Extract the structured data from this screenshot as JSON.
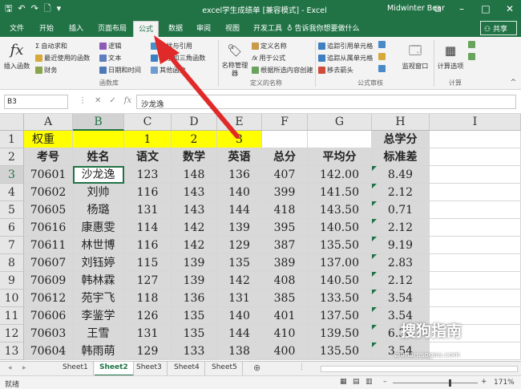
{
  "titlebar": {
    "title": "excel学生成绩单 [兼容模式] - Excel",
    "user": "Midwinter Bear",
    "qat_icons": [
      "save-icon",
      "undo-icon",
      "redo-icon",
      "new-file-icon",
      "more-icon"
    ]
  },
  "tabs": [
    "文件",
    "开始",
    "插入",
    "页面布局",
    "公式",
    "数据",
    "审阅",
    "视图",
    "开发工具"
  ],
  "active_tab": "公式",
  "tellme": "告诉我你想要做什么",
  "share": "共享",
  "ribbon": {
    "insert_function": "插入函数",
    "autosum": "自动求和",
    "recent": "最近使用的函数",
    "financial": "财务",
    "logical": "逻辑",
    "text": "文本",
    "datetime": "日期和时间",
    "lookup": "查找与引用",
    "math": "数学和三角函数",
    "other": "其他函数",
    "group_functions": "函数库",
    "name_manager": "名称管理器",
    "define_name": "定义名称",
    "use_in_formula": "用于公式",
    "create_from_sel": "根据所选内容创建",
    "group_names": "定义的名称",
    "trace_precedents": "追踪引用单元格",
    "trace_dependents": "追踪从属单元格",
    "remove_arrows": "移去箭头",
    "group_audit": "公式审核",
    "watch_window": "监视窗口",
    "calc_options": "计算选项",
    "group_calc": "计算"
  },
  "formulabar": {
    "name_box": "B3",
    "fx": "fx",
    "value": "沙龙逸"
  },
  "columns": [
    "A",
    "B",
    "C",
    "D",
    "E",
    "F",
    "G",
    "H",
    "I"
  ],
  "rows": [
    "1",
    "2",
    "3",
    "4",
    "5",
    "6",
    "7",
    "8",
    "9",
    "10",
    "11",
    "12",
    "13"
  ],
  "sheet": {
    "row1": {
      "a": "权重",
      "c": "1",
      "d": "2",
      "e": "3",
      "h": "总学分"
    },
    "headers": [
      "考号",
      "姓名",
      "语文",
      "数学",
      "英语",
      "总分",
      "平均分",
      "标准差"
    ],
    "data": [
      [
        "70601",
        "沙龙逸",
        "123",
        "148",
        "136",
        "407",
        "142.00",
        "8.49"
      ],
      [
        "70602",
        "刘帅",
        "116",
        "143",
        "140",
        "399",
        "141.50",
        "2.12"
      ],
      [
        "70605",
        "杨璐",
        "131",
        "143",
        "144",
        "418",
        "143.50",
        "0.71"
      ],
      [
        "70616",
        "康惠雯",
        "114",
        "142",
        "139",
        "395",
        "140.50",
        "2.12"
      ],
      [
        "70611",
        "林世博",
        "116",
        "142",
        "129",
        "387",
        "135.50",
        "9.19"
      ],
      [
        "70607",
        "刘钰婷",
        "115",
        "139",
        "135",
        "389",
        "137.00",
        "2.83"
      ],
      [
        "70609",
        "韩林霖",
        "127",
        "139",
        "142",
        "408",
        "140.50",
        "2.12"
      ],
      [
        "70612",
        "苑宇飞",
        "118",
        "136",
        "131",
        "385",
        "133.50",
        "3.54"
      ],
      [
        "70606",
        "李鉴学",
        "126",
        "135",
        "140",
        "401",
        "137.50",
        "3.54"
      ],
      [
        "70603",
        "王雪",
        "131",
        "135",
        "144",
        "410",
        "139.50",
        "6.36"
      ],
      [
        "70604",
        "韩雨萌",
        "129",
        "133",
        "138",
        "400",
        "135.50",
        "3.54"
      ]
    ]
  },
  "sheets": [
    "Sheet1",
    "Sheet2",
    "Sheet3",
    "Sheet4",
    "Sheet5"
  ],
  "active_sheet": "Sheet2",
  "status": {
    "ready": "就绪",
    "zoom": "171%"
  },
  "watermark": {
    "text": "搜狗指南",
    "url": "zhinan.sogou.com"
  },
  "colors": {
    "brand": "#217346",
    "highlight_yellow": "#ffff00",
    "gray_fill": "#d9d9d9",
    "arrow_red": "#e02a2a"
  }
}
